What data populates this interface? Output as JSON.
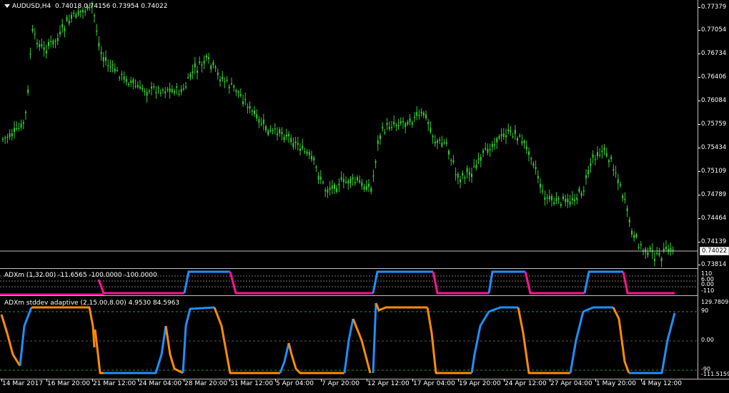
{
  "main": {
    "symbol": "AUDUSD,H4",
    "ohlc": "0.74018 0.74156 0.73954 0.74022",
    "current_price": "0.74022",
    "price_ticks": [
      "0.77379",
      "0.77054",
      "0.76734",
      "0.76406",
      "0.76084",
      "0.75759",
      "0.75434",
      "0.75109",
      "0.74789",
      "0.74464",
      "0.74139",
      "0.73814"
    ],
    "colors": {
      "candle": "#32cd32",
      "grid": "#c0c0c0",
      "background": "#000000"
    }
  },
  "adx": {
    "title": "ADXm (1,32.00) -11.6565 -100.0000 -100.0000",
    "ticks": [
      "110",
      "6.00",
      "0.00",
      "-110"
    ],
    "colors": {
      "up": "#1e90ff",
      "down": "#ff1493"
    }
  },
  "adxs": {
    "title": "ADXm stddev adaptive (2,15.00,8.00) 4.9530 84.5963",
    "ticks": [
      "129.7809",
      "90",
      "0.00",
      "-90",
      "-111.5159"
    ],
    "colors": {
      "up": "#1e90ff",
      "down": "#ff8c00"
    }
  },
  "time_axis": [
    "14 Mar 2017",
    "16 Mar 20:00",
    "21 Mar 12:00",
    "24 Mar 04:00",
    "28 Mar 20:00",
    "31 Mar 12:00",
    "5 Apr 04:00",
    "7 Apr 20:00",
    "12 Apr 12:00",
    "17 Apr 04:00",
    "19 Apr 20:00",
    "24 Apr 12:00",
    "27 Apr 04:00",
    "1 May 20:00",
    "4 May 12:00"
  ]
}
